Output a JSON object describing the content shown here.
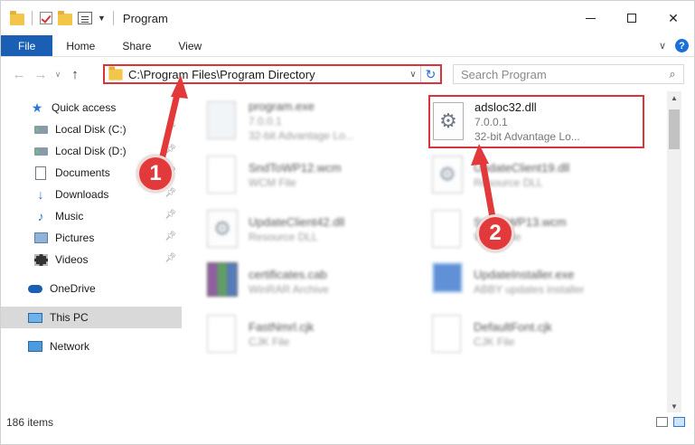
{
  "window": {
    "title": "Program"
  },
  "ribbon": {
    "tabs": [
      "File",
      "Home",
      "Share",
      "View"
    ]
  },
  "address": {
    "path": "C:\\Program Files\\Program Directory"
  },
  "search": {
    "placeholder": "Search Program"
  },
  "navpane": {
    "items": [
      {
        "label": "Quick access",
        "icon": "star-icon"
      },
      {
        "label": "Local Disk (C:)",
        "icon": "disk-icon",
        "pinned": true
      },
      {
        "label": "Local Disk (D:)",
        "icon": "disk-icon",
        "pinned": true
      },
      {
        "label": "Documents",
        "icon": "documents-icon",
        "pinned": true
      },
      {
        "label": "Downloads",
        "icon": "downloads-icon",
        "pinned": true
      },
      {
        "label": "Music",
        "icon": "music-icon",
        "pinned": true
      },
      {
        "label": "Pictures",
        "icon": "pictures-icon",
        "pinned": true
      },
      {
        "label": "Videos",
        "icon": "videos-icon",
        "pinned": true
      },
      {
        "label": "OneDrive",
        "icon": "onedrive-icon"
      },
      {
        "label": "This PC",
        "icon": "this-pc-icon",
        "selected": true
      },
      {
        "label": "Network",
        "icon": "network-icon"
      }
    ]
  },
  "files": [
    {
      "name": "program.exe",
      "line2": "7.0.0.1",
      "line3": "32-bit Advantage Lo...",
      "type": "exe"
    },
    {
      "name": "SndToWP12.wcm",
      "line2": "WCM File",
      "type": "page"
    },
    {
      "name": "UpdateClient19.dll",
      "line2": "Resource DLL",
      "type": "gear"
    },
    {
      "name": "UpdateClient42.dll",
      "line2": "Resource DLL",
      "type": "gear"
    },
    {
      "name": "SndToWP13.wcm",
      "line2": "WCM File",
      "type": "page"
    },
    {
      "name": "certificates.cab",
      "line2": "WinRAR Archive",
      "type": "rar"
    },
    {
      "name": "UpdateInstaller.exe",
      "line2": "ABBY updates installer",
      "type": "setup"
    },
    {
      "name": "FastNmrl.cjk",
      "line2": "CJK File",
      "type": "page"
    },
    {
      "name": "DefaultFont.cjk",
      "line2": "CJK File",
      "type": "page"
    }
  ],
  "selected_file": {
    "name": "adsloc32.dll",
    "version": "7.0.0.1",
    "description": "32-bit Advantage Lo..."
  },
  "status": {
    "item_count": "186 items"
  },
  "callouts": [
    "1",
    "2"
  ],
  "colors": {
    "accent": "#1a5fb4",
    "highlight": "#d9343a",
    "badge": "#e23a3a"
  }
}
